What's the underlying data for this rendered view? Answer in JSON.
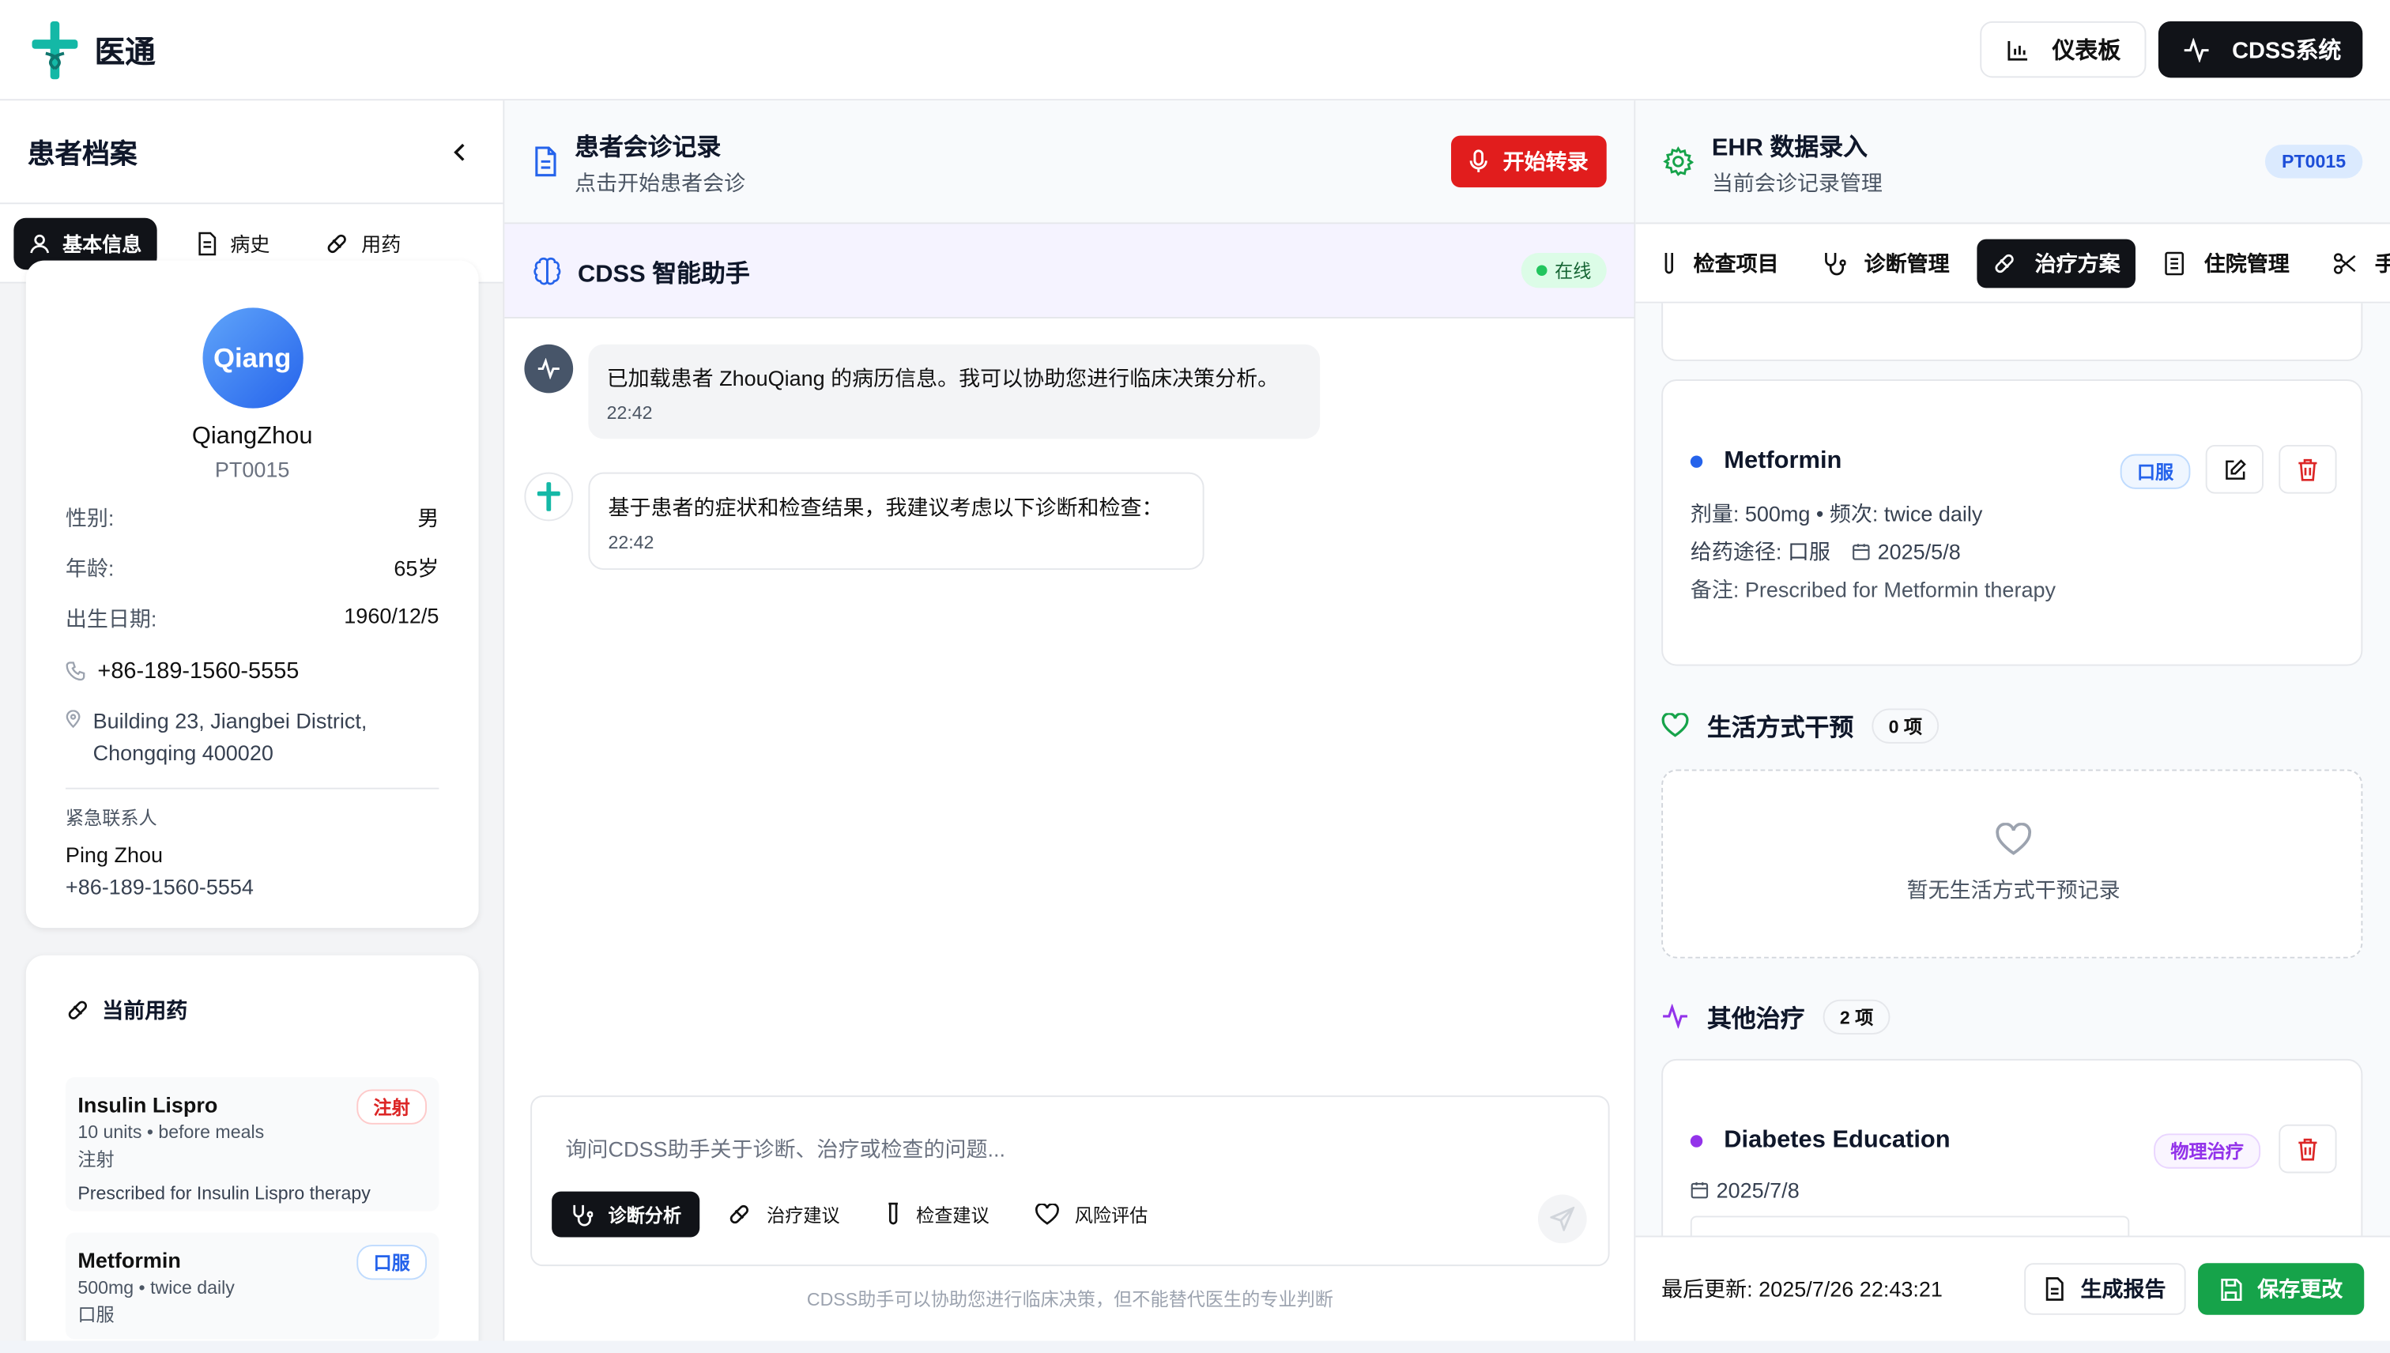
{
  "app": {
    "name": "医通"
  },
  "header": {
    "dashboard_label": "仪表板",
    "cdss_label": "CDSS系统"
  },
  "left": {
    "title": "患者档案",
    "tabs": [
      {
        "label": "基本信息"
      },
      {
        "label": "病史"
      },
      {
        "label": "用药"
      }
    ],
    "patient": {
      "avatar_text": "Qiang",
      "name": "QiangZhou",
      "id": "PT0015",
      "fields": [
        {
          "k": "性别:",
          "v": "男"
        },
        {
          "k": "年龄:",
          "v": "65岁"
        },
        {
          "k": "出生日期:",
          "v": "1960/12/5"
        }
      ],
      "phone": "+86-189-1560-5555",
      "address_line1": "Building 23, Jiangbei District,",
      "address_line2": "Chongqing 400020",
      "emergency_label": "紧急联系人",
      "emergency_name": "Ping Zhou",
      "emergency_phone": "+86-189-1560-5554"
    },
    "meds_title": "当前用药",
    "meds": [
      {
        "name": "Insulin Lispro",
        "badge": "注射",
        "dose": "10 units • before meals",
        "route": "注射",
        "note": "Prescribed for Insulin Lispro therapy"
      },
      {
        "name": "Metformin",
        "badge": "口服",
        "dose": "500mg • twice daily",
        "route": "口服"
      }
    ]
  },
  "mid": {
    "title": "患者会诊记录",
    "subtitle": "点击开始患者会诊",
    "record_label": "开始转录",
    "cdss_title": "CDSS 智能助手",
    "status": "在线",
    "messages": [
      {
        "text": "已加载患者 ZhouQiang 的病历信息。我可以协助您进行临床决策分析。",
        "time": "22:42"
      },
      {
        "text": "基于患者的症状和检查结果，我建议考虑以下诊断和检查：",
        "time": "22:42"
      }
    ],
    "input_placeholder": "询问CDSS助手关于诊断、治疗或检查的问题...",
    "chips": [
      {
        "label": "诊断分析"
      },
      {
        "label": "治疗建议"
      },
      {
        "label": "检查建议"
      },
      {
        "label": "风险评估"
      }
    ],
    "disclaimer": "CDSS助手可以协助您进行临床决策，但不能替代医生的专业判断"
  },
  "right": {
    "title": "EHR 数据录入",
    "subtitle": "当前会诊记录管理",
    "patient_id": "PT0015",
    "tabs": [
      {
        "label": "检查项目"
      },
      {
        "label": "诊断管理"
      },
      {
        "label": "治疗方案"
      },
      {
        "label": "住院管理"
      },
      {
        "label": "手术"
      }
    ],
    "med_card": {
      "name": "Metformin",
      "badge": "口服",
      "dose_line": "剂量: 500mg • 频次: twice daily",
      "route_line": "给药途径: 口服",
      "date": "2025/5/8",
      "note": "备注: Prescribed for Metformin therapy"
    },
    "lifestyle_title": "生活方式干预",
    "lifestyle_count": "0 项",
    "lifestyle_empty": "暂无生活方式干预记录",
    "other_title": "其他治疗",
    "other_count": "2 项",
    "other_card": {
      "name": "Diabetes Education",
      "badge": "物理治疗",
      "date": "2025/7/8"
    },
    "footer": {
      "updated": "最后更新: 2025/7/26 22:43:21",
      "report_label": "生成报告",
      "save_label": "保存更改"
    }
  },
  "colors": {
    "accent_dark": "#111318",
    "record_red": "#e11d1d",
    "save_green": "#16a34a",
    "brand_teal": "#14b8a6"
  }
}
